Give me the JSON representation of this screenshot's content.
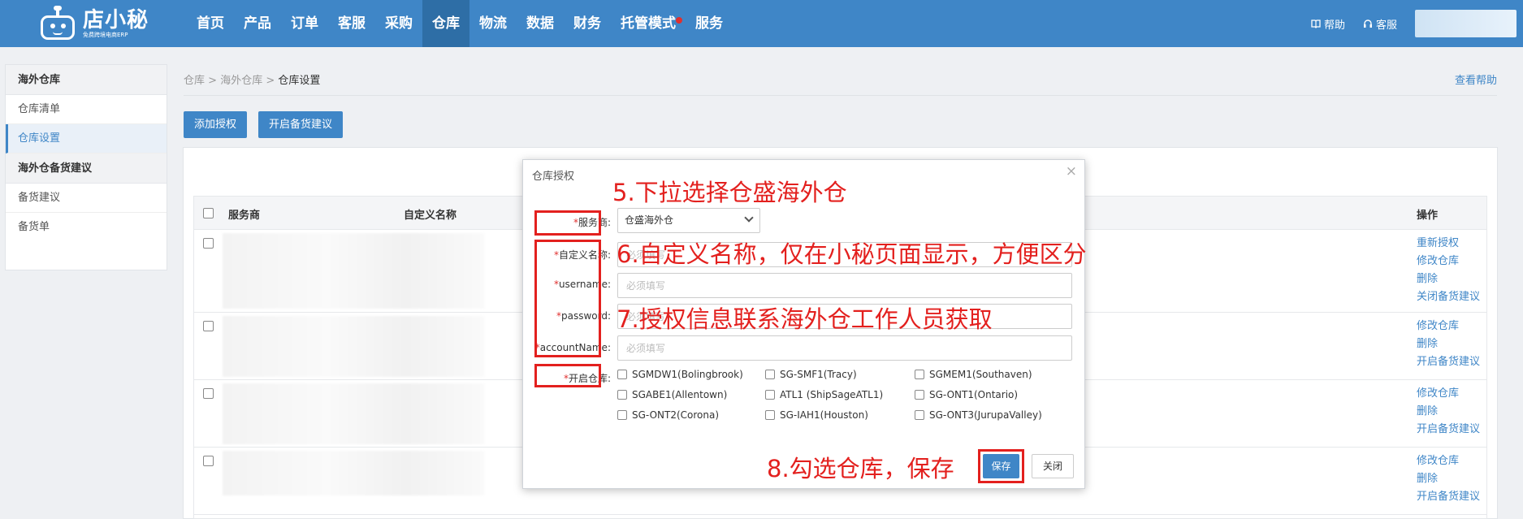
{
  "brand": {
    "name": "店小秘",
    "tagline": "免费跨境电商ERP"
  },
  "nav": {
    "items": [
      "首页",
      "产品",
      "订单",
      "客服",
      "采购",
      "仓库",
      "物流",
      "数据",
      "财务",
      "托管模式",
      "服务"
    ],
    "active": "仓库"
  },
  "topbar": {
    "help": "帮助",
    "service": "客服"
  },
  "sidebar": {
    "section1": "海外仓库",
    "item_list": "仓库清单",
    "item_settings": "仓库设置",
    "section2": "海外仓备货建议",
    "item_suggest": "备货建议",
    "item_orders": "备货单"
  },
  "breadcrumb": {
    "c1": "仓库",
    "c2": "海外仓库",
    "current": "仓库设置",
    "sep": ">"
  },
  "help_link": "查看帮助",
  "buttons": {
    "add_auth": "添加授权",
    "enable_stock": "开启备货建议"
  },
  "table": {
    "col_provider": "服务商",
    "col_custom": "自定义名称",
    "col_action": "操作",
    "rows": [
      {
        "actions": [
          "重新授权",
          "修改仓库",
          "删除",
          "关闭备货建议"
        ]
      },
      {
        "actions": [
          "修改仓库",
          "删除",
          "开启备货建议"
        ]
      },
      {
        "actions": [
          "修改仓库",
          "删除",
          "开启备货建议"
        ]
      },
      {
        "actions": [
          "修改仓库",
          "删除",
          "开启备货建议"
        ]
      }
    ]
  },
  "modal": {
    "title": "仓库授权",
    "close": "×",
    "provider_label": "服务商:",
    "provider_value": "仓盛海外仓",
    "custom_name_label": "自定义名称:",
    "username_label": "username:",
    "password_label": "password:",
    "account_label": "accountName:",
    "placeholder": "必须填写",
    "warehouse_label": "开启仓库:",
    "warehouses": [
      "SGMDW1(Bolingbrook)",
      "SG-SMF1(Tracy)",
      "SGMEM1(Southaven)",
      "SGABE1(Allentown)",
      "ATL1 (ShipSageATL1)",
      "SG-ONT1(Ontario)",
      "SG-ONT2(Corona)",
      "SG-IAH1(Houston)",
      "SG-ONT3(JurupaValley)"
    ],
    "save": "保存",
    "cancel": "关闭"
  },
  "annotations": {
    "a5": "5.下拉选择仓盛海外仓",
    "a6": "6.自定义名称，仅在小秘页面显示，方便区分",
    "a7": "7.授权信息联系海外仓工作人员获取",
    "a8": "8.勾选仓库，保存"
  },
  "colors": {
    "primary": "#3f86c7",
    "annotation_red": "#e3201e"
  }
}
